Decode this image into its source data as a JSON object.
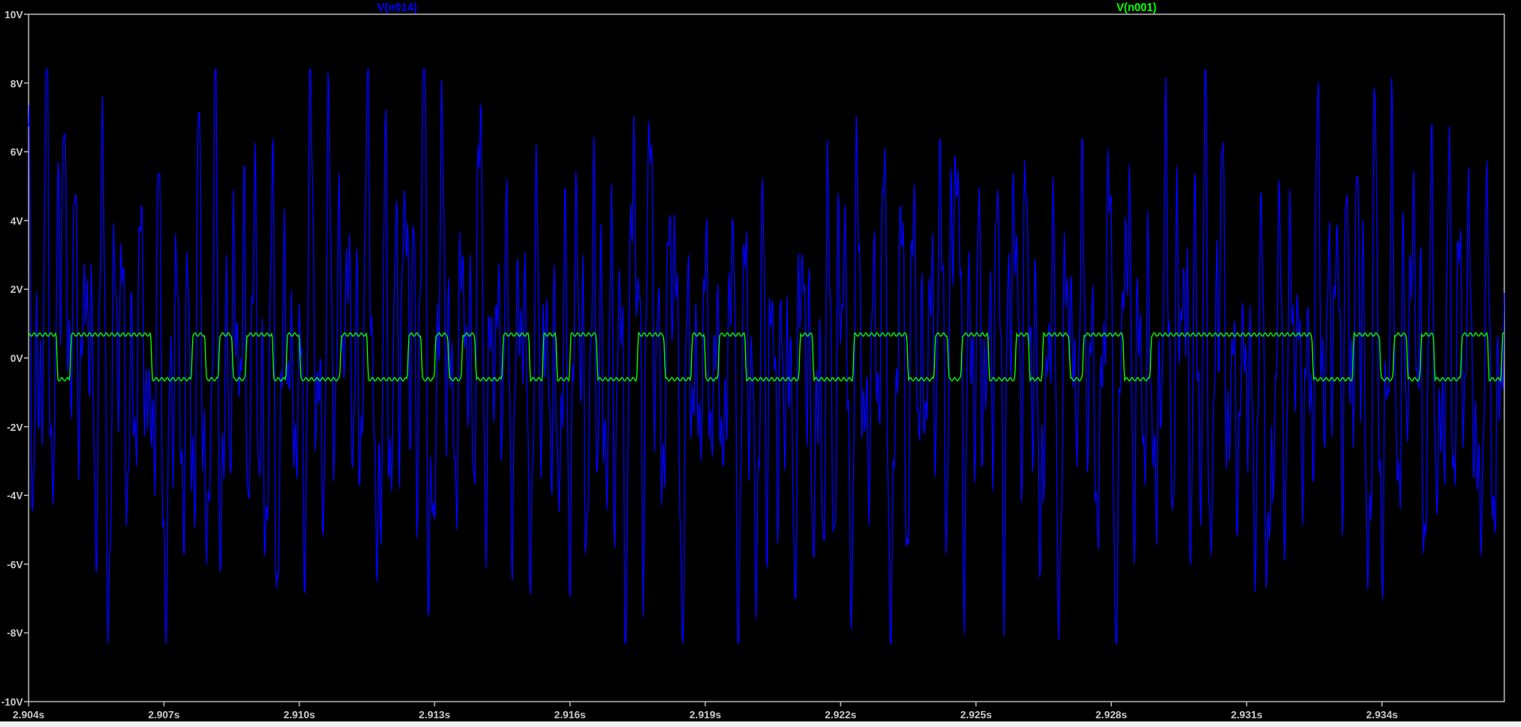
{
  "plot": {
    "traces": [
      {
        "label": "V(n014)",
        "color": "#0000ff",
        "kind": "noise"
      },
      {
        "label": "V(n001)",
        "color": "#00ff00",
        "kind": "square"
      }
    ],
    "y_axis": {
      "ticks": [
        "10V",
        "8V",
        "6V",
        "4V",
        "2V",
        "0V",
        "-2V",
        "-4V",
        "-6V",
        "-8V",
        "-10V"
      ]
    },
    "x_axis": {
      "ticks": [
        "2.904s",
        "2.907s",
        "2.910s",
        "2.913s",
        "2.916s",
        "2.919s",
        "2.922s",
        "2.925s",
        "2.928s",
        "2.931s",
        "2.934s"
      ]
    }
  }
}
